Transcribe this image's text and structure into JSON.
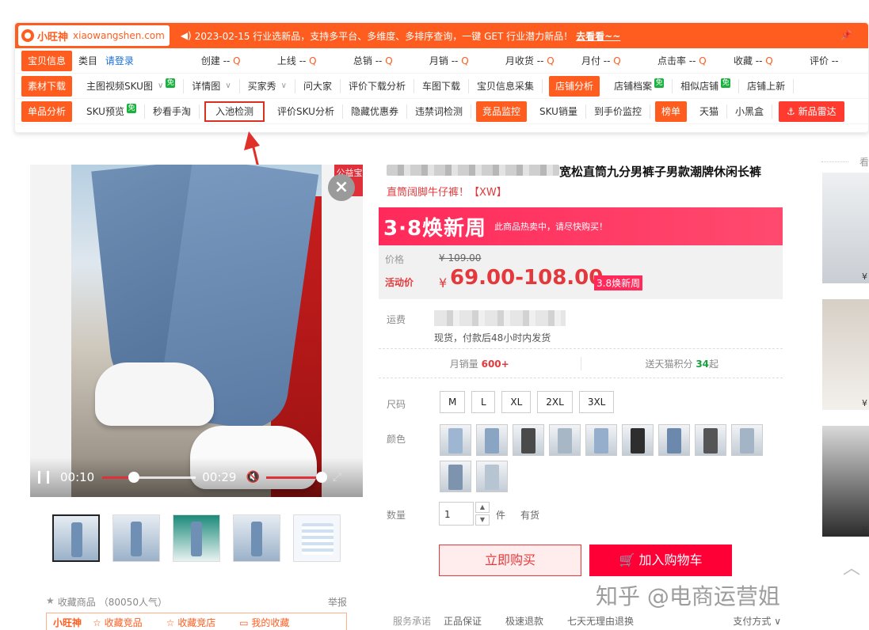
{
  "plugin": {
    "logo_name": "小旺神",
    "logo_site": "xiaowangshen.com",
    "notice": "2023-02-15 行业选新品，支持多平台、多维度、多排序查询，一键 GET 行业潜力新品！",
    "notice_link": "去看看~~",
    "pin_icon": "pin-icon",
    "row1": {
      "tag": "宝贝信息",
      "category_label": "类目",
      "login_label": "请登录",
      "items": [
        {
          "label": "创建 -- "
        },
        {
          "label": "上线 -- "
        },
        {
          "label": "总销 -- "
        },
        {
          "label": "月销 -- "
        },
        {
          "label": "月收货 -- "
        },
        {
          "label": "月付 -- "
        },
        {
          "label": "点击率 -- "
        },
        {
          "label": "收藏 -- "
        },
        {
          "label": "评价 --"
        }
      ]
    },
    "row2": {
      "tag": "素材下载",
      "items": [
        "主图视频SKU图",
        "详情图",
        "买家秀",
        "问大家",
        "评价下载分析",
        "车图下载",
        "宝贝信息采集"
      ],
      "tag2": "店铺分析",
      "items2": [
        "店铺档案",
        "相似店铺",
        "店铺上新"
      ],
      "free_label": "免"
    },
    "row3": {
      "tag": "单品分析",
      "items": [
        "SKU预览",
        "秒看手淘"
      ],
      "boxed": "入池检测",
      "items_b": [
        "评价SKU分析",
        "隐藏优惠券",
        "违禁词检测"
      ],
      "tag2": "竞品监控",
      "items2": [
        "SKU销量",
        "到手价监控"
      ],
      "tag3": "榜单",
      "items3": [
        "天猫",
        "小黑盒"
      ],
      "radar": "新品雷达"
    }
  },
  "gallery": {
    "charity": "公益宝贝",
    "current_time": "00:10",
    "duration": "00:29",
    "progress": 0.34,
    "volume": 1.0,
    "thumbnails": 5,
    "collect_label": "收藏商品",
    "collect_count": "（80050人气）",
    "report": "举报",
    "ww_logo": "小旺神",
    "ww_links": [
      "收藏竞品",
      "收藏竞店",
      "我的收藏"
    ]
  },
  "product": {
    "title": "宽松直筒九分男裤子男款潮牌休闲长裤",
    "subtitle": "直筒阔脚牛仔裤！【XW】",
    "promo_logo": "3·8焕新周",
    "promo_note": "此商品热卖中，请尽快购买！",
    "price_label": "价格",
    "original_price": "¥ 109.00",
    "activity_label": "活动价",
    "yen": "¥",
    "activity_price": "69.00-108.00",
    "price_tag": "3.8焕新周",
    "shipping_label": "运费",
    "shipping_note": "现货，付款后48小时内发货",
    "monthly_sales_label": "月销量",
    "monthly_sales": "600+",
    "points_label": "送天猫积分",
    "points": "34",
    "points_suffix": "起",
    "size_label": "尺码",
    "sizes": [
      "M",
      "L",
      "XL",
      "2XL",
      "3XL"
    ],
    "color_label": "颜色",
    "swatch_count": 11,
    "quantity_label": "数量",
    "quantity": "1",
    "unit": "件",
    "stock": "有货",
    "buy_now": "立即购买",
    "add_cart": "加入购物车",
    "service_label": "服务承诺",
    "services": [
      "正品保证",
      "极速退款",
      "七天无理由退换"
    ],
    "payment": "支付方式 ∨"
  },
  "recommend": {
    "header": "看",
    "price_symbol": "¥"
  },
  "watermark": "知乎 @电商运营姐",
  "colors": {
    "brand_orange": "#ff5d1f",
    "price_red": "#e4393c",
    "cart_red": "#ff0036",
    "annotation_red": "#d9301f"
  }
}
